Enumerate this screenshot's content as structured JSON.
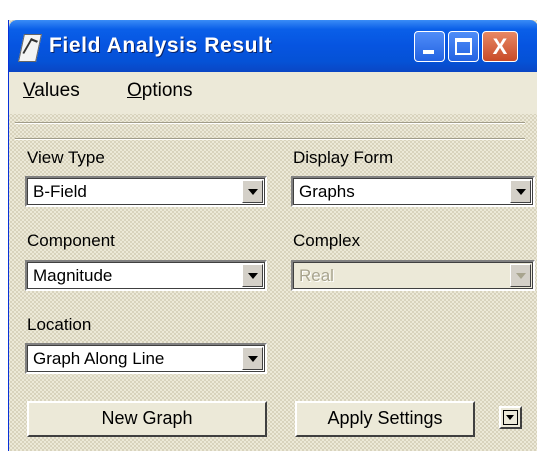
{
  "window": {
    "title": "Field Analysis Result",
    "controls": {
      "minimize": "minimize",
      "maximize": "maximize",
      "close": "X"
    }
  },
  "menu": {
    "items": [
      {
        "label_first": "V",
        "label_rest": "alues"
      },
      {
        "label_first": "O",
        "label_rest": "ptions"
      }
    ]
  },
  "form": {
    "view_type": {
      "label": "View Type",
      "value": "B-Field"
    },
    "display_form": {
      "label": "Display Form",
      "value": "Graphs"
    },
    "component": {
      "label": "Component",
      "value": "Magnitude"
    },
    "complex": {
      "label": "Complex",
      "value": "Real",
      "enabled": false
    },
    "location": {
      "label": "Location",
      "value": "Graph Along Line"
    }
  },
  "buttons": {
    "new_graph": "New Graph",
    "apply_settings": "Apply Settings"
  },
  "icons": {
    "app": "field-icon",
    "dropdown": "chevron-down-icon",
    "expand": "expand-icon"
  }
}
